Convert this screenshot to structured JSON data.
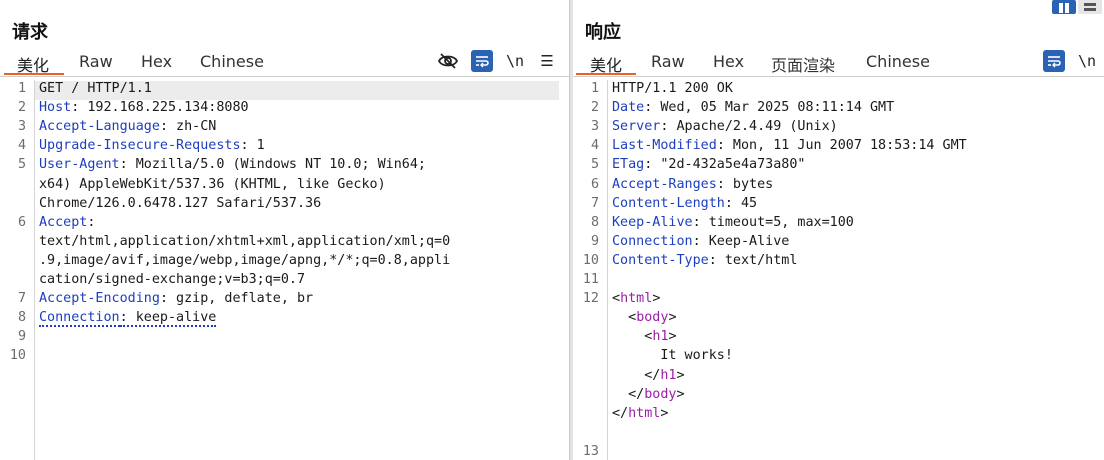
{
  "request": {
    "title": "请求",
    "tabs": [
      "美化",
      "Raw",
      "Hex",
      "Chinese"
    ],
    "lines": [
      {
        "n": "1",
        "text": "GET / HTTP/1.1"
      },
      {
        "n": "2",
        "key": "Host",
        "val": ": 192.168.225.134:8080"
      },
      {
        "n": "3",
        "key": "Accept-Language",
        "val": ": zh-CN"
      },
      {
        "n": "4",
        "key": "Upgrade-Insecure-Requests",
        "val": ": 1"
      },
      {
        "n": "5",
        "key": "User-Agent",
        "val": ": Mozilla/5.0 (Windows NT 10.0; Win64;"
      },
      {
        "n": "",
        "text": "x64) AppleWebKit/537.36 (KHTML, like Gecko)"
      },
      {
        "n": "",
        "text": "Chrome/126.0.6478.127 Safari/537.36"
      },
      {
        "n": "6",
        "key": "Accept",
        "val": ":"
      },
      {
        "n": "",
        "text": "text/html,application/xhtml+xml,application/xml;q=0"
      },
      {
        "n": "",
        "text": ".9,image/avif,image/webp,image/apng,*/*;q=0.8,appli"
      },
      {
        "n": "",
        "text": "cation/signed-exchange;v=b3;q=0.7"
      },
      {
        "n": "7",
        "key": "Accept-Encoding",
        "val": ": gzip, deflate, br"
      },
      {
        "n": "8",
        "key": "Connection",
        "val": ": keep-alive",
        "dotted": true
      },
      {
        "n": "9",
        "text": ""
      },
      {
        "n": "10",
        "text": ""
      }
    ]
  },
  "response": {
    "title": "响应",
    "tabs": [
      "美化",
      "Raw",
      "Hex",
      "页面渲染",
      "Chinese"
    ],
    "lines": [
      {
        "n": "1",
        "text": "HTTP/1.1 200 OK"
      },
      {
        "n": "2",
        "key": "Date",
        "val": ": Wed, 05 Mar 2025 08:11:14 GMT"
      },
      {
        "n": "3",
        "key": "Server",
        "val": ": Apache/2.4.49 (Unix)"
      },
      {
        "n": "4",
        "key": "Last-Modified",
        "val": ": Mon, 11 Jun 2007 18:53:14 GMT"
      },
      {
        "n": "5",
        "key": "ETag",
        "val": ": \"2d-432a5e4a73a80\""
      },
      {
        "n": "6",
        "key": "Accept-Ranges",
        "val": ": bytes"
      },
      {
        "n": "7",
        "key": "Content-Length",
        "val": ": 45"
      },
      {
        "n": "8",
        "key": "Keep-Alive",
        "val": ": timeout=5, max=100"
      },
      {
        "n": "9",
        "key": "Connection",
        "val": ": Keep-Alive"
      },
      {
        "n": "10",
        "key": "Content-Type",
        "val": ": text/html"
      },
      {
        "n": "11",
        "text": ""
      },
      {
        "n": "12",
        "pre": "",
        "open": "<",
        "tag": "html",
        "close": ">"
      },
      {
        "n": "",
        "pre": "  ",
        "open": "<",
        "tag": "body",
        "close": ">"
      },
      {
        "n": "",
        "pre": "    ",
        "open": "<",
        "tag": "h1",
        "close": ">"
      },
      {
        "n": "",
        "text": "      It works!"
      },
      {
        "n": "",
        "pre": "    ",
        "open": "</",
        "tag": "h1",
        "close": ">"
      },
      {
        "n": "",
        "pre": "  ",
        "open": "</",
        "tag": "body",
        "close": ">"
      },
      {
        "n": "",
        "pre": "",
        "open": "</",
        "tag": "html",
        "close": ">"
      },
      {
        "n": "",
        "text": ""
      },
      {
        "n": "13",
        "text": ""
      }
    ]
  },
  "tools": {
    "newline_label": "\\n",
    "menu_label": "☰"
  }
}
